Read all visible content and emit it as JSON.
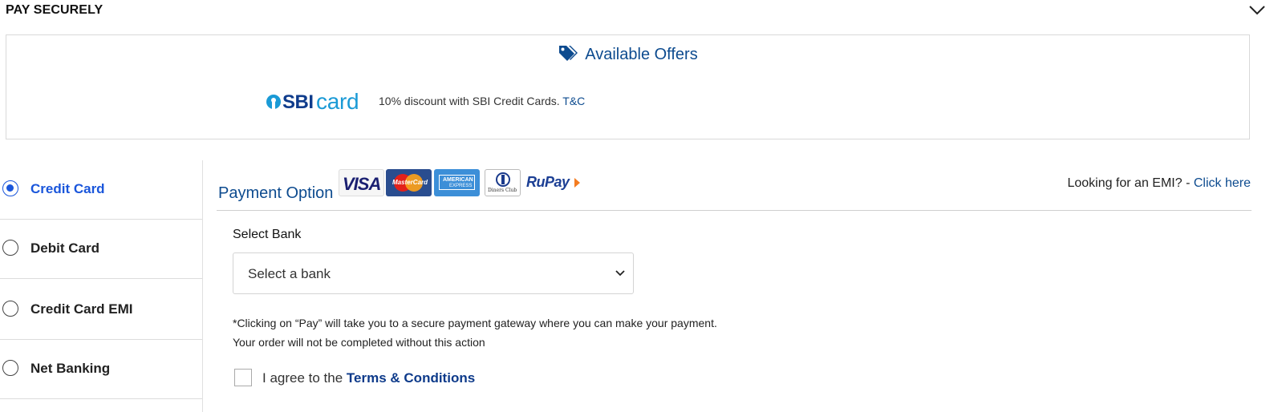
{
  "header": {
    "title": "PAY SECURELY",
    "collapse_icon": "chevron-down-icon"
  },
  "offers": {
    "title": "Available Offers",
    "title_icon": "tags-icon",
    "items": [
      {
        "logo": {
          "sbi": "SBI",
          "card": "card"
        },
        "text": "10% discount with SBI Credit Cards.",
        "link": "T&C"
      }
    ]
  },
  "payment_methods": [
    {
      "label": "Credit Card",
      "selected": true
    },
    {
      "label": "Debit Card",
      "selected": false
    },
    {
      "label": "Credit Card EMI",
      "selected": false
    },
    {
      "label": "Net Banking",
      "selected": false
    }
  ],
  "payment_option": {
    "title": "Payment Option",
    "card_logos": {
      "visa": "VISA",
      "mastercard": "MasterCard",
      "amex_1": "AMERICAN",
      "amex_2": "EXPRESS",
      "diners": "Diners Club",
      "rupay": "RuPay"
    },
    "emi_prompt": "Looking for an EMI? -",
    "emi_link": "Click here"
  },
  "bank": {
    "label": "Select Bank",
    "selected": "Select a bank"
  },
  "notes": {
    "line1": "*Clicking on “Pay” will take you to a secure payment gateway where you can make your payment.",
    "line2": "Your order will not be completed without this action"
  },
  "agree": {
    "text": "I agree to the",
    "link": "Terms & Conditions",
    "checked": false
  },
  "colors": {
    "accent": "#0d4b8f",
    "selected": "#1a56db",
    "sbi_blue": "#1a9ad6"
  }
}
